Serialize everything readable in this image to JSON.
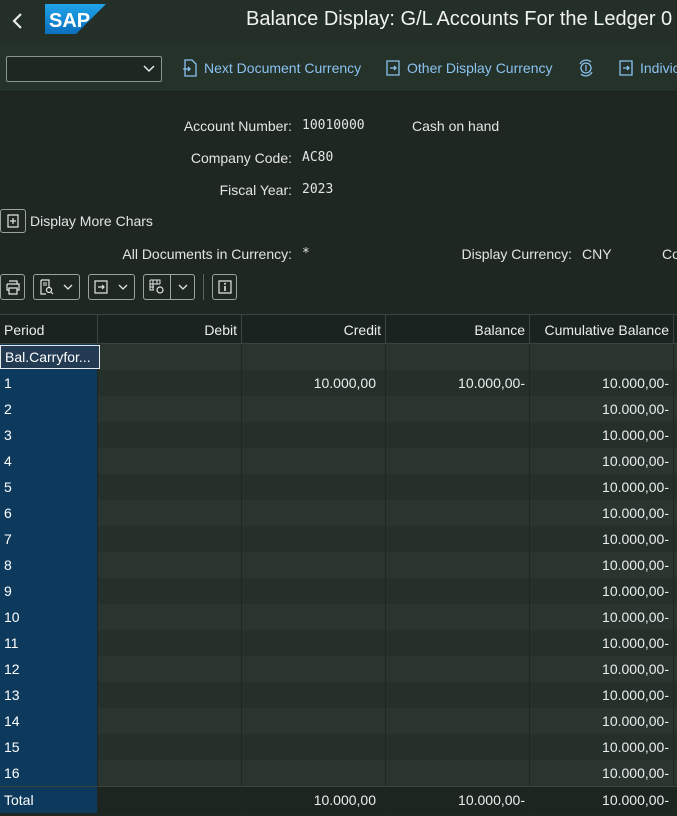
{
  "shell": {
    "title": "Balance Display: G/L Accounts For the Ledger 0",
    "logo_text": "SAP"
  },
  "toolbar": {
    "variant_value": "",
    "next_doc_currency": "Next Document Currency",
    "other_display_currency": "Other Display Currency",
    "individual": "Indivic"
  },
  "info": {
    "account_number_label": "Account Number:",
    "account_number_value": "10010000",
    "account_name": "Cash on hand",
    "company_code_label": "Company Code:",
    "company_code_value": "AC80",
    "fiscal_year_label": "Fiscal Year:",
    "fiscal_year_value": "2023",
    "display_more_chars": "Display More Chars",
    "all_docs_label": "All Documents in Currency:",
    "all_docs_value": "*",
    "display_currency_label": "Display Currency:",
    "display_currency_value": "CNY",
    "trailing_label": "Co"
  },
  "table": {
    "headers": {
      "period": "Period",
      "debit": "Debit",
      "credit": "Credit",
      "balance": "Balance",
      "cumulative": "Cumulative Balance"
    },
    "carryforward": {
      "period": "Bal.Carryfor...",
      "debit": "",
      "credit": "",
      "balance": "",
      "cumulative": ""
    },
    "rows": [
      {
        "period": "1",
        "debit": "",
        "credit": "10.000,00",
        "balance": "10.000,00-",
        "cumulative": "10.000,00-"
      },
      {
        "period": "2",
        "debit": "",
        "credit": "",
        "balance": "",
        "cumulative": "10.000,00-"
      },
      {
        "period": "3",
        "debit": "",
        "credit": "",
        "balance": "",
        "cumulative": "10.000,00-"
      },
      {
        "period": "4",
        "debit": "",
        "credit": "",
        "balance": "",
        "cumulative": "10.000,00-"
      },
      {
        "period": "5",
        "debit": "",
        "credit": "",
        "balance": "",
        "cumulative": "10.000,00-"
      },
      {
        "period": "6",
        "debit": "",
        "credit": "",
        "balance": "",
        "cumulative": "10.000,00-"
      },
      {
        "period": "7",
        "debit": "",
        "credit": "",
        "balance": "",
        "cumulative": "10.000,00-"
      },
      {
        "period": "8",
        "debit": "",
        "credit": "",
        "balance": "",
        "cumulative": "10.000,00-"
      },
      {
        "period": "9",
        "debit": "",
        "credit": "",
        "balance": "",
        "cumulative": "10.000,00-"
      },
      {
        "period": "10",
        "debit": "",
        "credit": "",
        "balance": "",
        "cumulative": "10.000,00-"
      },
      {
        "period": "11",
        "debit": "",
        "credit": "",
        "balance": "",
        "cumulative": "10.000,00-"
      },
      {
        "period": "12",
        "debit": "",
        "credit": "",
        "balance": "",
        "cumulative": "10.000,00-"
      },
      {
        "period": "13",
        "debit": "",
        "credit": "",
        "balance": "",
        "cumulative": "10.000,00-"
      },
      {
        "period": "14",
        "debit": "",
        "credit": "",
        "balance": "",
        "cumulative": "10.000,00-"
      },
      {
        "period": "15",
        "debit": "",
        "credit": "",
        "balance": "",
        "cumulative": "10.000,00-"
      },
      {
        "period": "16",
        "debit": "",
        "credit": "",
        "balance": "",
        "cumulative": "10.000,00-"
      }
    ],
    "total": {
      "period": "Total",
      "debit": "",
      "credit": "10.000,00",
      "balance": "10.000,00-",
      "cumulative": "10.000,00-"
    }
  },
  "colors": {
    "brand_blue": "#1b8ed8",
    "link_blue": "#8ac2ef",
    "period_column": "#0d3a5c"
  }
}
